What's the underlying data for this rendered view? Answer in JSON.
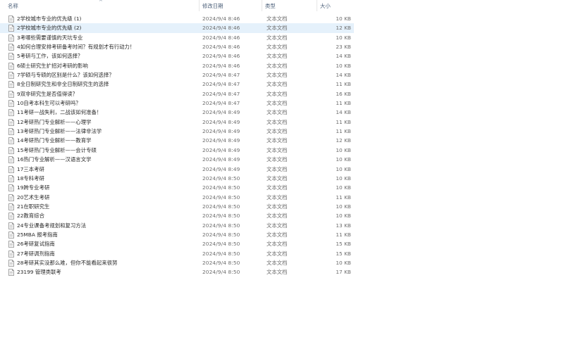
{
  "columns": {
    "name": "名称",
    "date": "修改日期",
    "type": "类型",
    "size": "大小"
  },
  "icons": {
    "sort": "sort-up-icon",
    "file": "text-file-icon"
  },
  "files": [
    {
      "name": "2学校城市专业的优先级 (1)",
      "date": "2024/9/4 8:46",
      "type": "文本文档",
      "size": "10 KB",
      "selected": false
    },
    {
      "name": "2学校城市专业的优先级 (2)",
      "date": "2024/9/4 8:46",
      "type": "文本文档",
      "size": "12 KB",
      "selected": true
    },
    {
      "name": "3考哪些需要谨慎的天坑专业",
      "date": "2024/9/4 8:46",
      "type": "文本文档",
      "size": "10 KB",
      "selected": false
    },
    {
      "name": "4如何合理安排考研备考时间？有规划才有行动力！",
      "date": "2024/9/4 8:46",
      "type": "文本文档",
      "size": "23 KB",
      "selected": false
    },
    {
      "name": "5考研与工作，该如何选择？",
      "date": "2024/9/4 8:46",
      "type": "文本文档",
      "size": "14 KB",
      "selected": false
    },
    {
      "name": "6硕士研究生扩招对考研的影响",
      "date": "2024/9/4 8:46",
      "type": "文本文档",
      "size": "10 KB",
      "selected": false
    },
    {
      "name": "7学硕与专硕的区别是什么？该如何选择？",
      "date": "2024/9/4 8:47",
      "type": "文本文档",
      "size": "14 KB",
      "selected": false
    },
    {
      "name": "8全日制研究生和非全日制研究生的选择",
      "date": "2024/9/4 8:47",
      "type": "文本文档",
      "size": "11 KB",
      "selected": false
    },
    {
      "name": "9双非研究生是否值得读？",
      "date": "2024/9/4 8:47",
      "type": "文本文档",
      "size": "16 KB",
      "selected": false
    },
    {
      "name": "10自考本科生可以考研吗？",
      "date": "2024/9/4 8:47",
      "type": "文本文档",
      "size": "11 KB",
      "selected": false
    },
    {
      "name": "11考研一战失利，二战该如何准备！",
      "date": "2024/9/4 8:49",
      "type": "文本文档",
      "size": "14 KB",
      "selected": false
    },
    {
      "name": "12考研热门专业解析——心理学",
      "date": "2024/9/4 8:49",
      "type": "文本文档",
      "size": "11 KB",
      "selected": false
    },
    {
      "name": "13考研热门专业解析——法律非法学",
      "date": "2024/9/4 8:49",
      "type": "文本文档",
      "size": "11 KB",
      "selected": false
    },
    {
      "name": "14考研热门专业解析——教育学",
      "date": "2024/9/4 8:49",
      "type": "文本文档",
      "size": "12 KB",
      "selected": false
    },
    {
      "name": "15考研热门专业解析——会计专硕",
      "date": "2024/9/4 8:49",
      "type": "文本文档",
      "size": "10 KB",
      "selected": false
    },
    {
      "name": "16热门专业解析——汉语言文学",
      "date": "2024/9/4 8:49",
      "type": "文本文档",
      "size": "10 KB",
      "selected": false
    },
    {
      "name": "17三本考研",
      "date": "2024/9/4 8:49",
      "type": "文本文档",
      "size": "10 KB",
      "selected": false
    },
    {
      "name": "18专科考研",
      "date": "2024/9/4 8:50",
      "type": "文本文档",
      "size": "10 KB",
      "selected": false
    },
    {
      "name": "19跨专业考研",
      "date": "2024/9/4 8:50",
      "type": "文本文档",
      "size": "10 KB",
      "selected": false
    },
    {
      "name": "20艺术生考研",
      "date": "2024/9/4 8:50",
      "type": "文本文档",
      "size": "11 KB",
      "selected": false
    },
    {
      "name": "21在职研究生",
      "date": "2024/9/4 8:50",
      "type": "文本文档",
      "size": "10 KB",
      "selected": false
    },
    {
      "name": "22教育综合",
      "date": "2024/9/4 8:50",
      "type": "文本文档",
      "size": "10 KB",
      "selected": false
    },
    {
      "name": "24专业课备考规划和复习方法",
      "date": "2024/9/4 8:50",
      "type": "文本文档",
      "size": "13 KB",
      "selected": false
    },
    {
      "name": "25MBA 报考指南",
      "date": "2024/9/4 8:50",
      "type": "文本文档",
      "size": "11 KB",
      "selected": false
    },
    {
      "name": "26考研复试指南",
      "date": "2024/9/4 8:50",
      "type": "文本文档",
      "size": "15 KB",
      "selected": false
    },
    {
      "name": "27考研调剂指南",
      "date": "2024/9/4 8:50",
      "type": "文本文档",
      "size": "15 KB",
      "selected": false
    },
    {
      "name": "28考研其实没那么难，但你不能看起来很努",
      "date": "2024/9/4 8:50",
      "type": "文本文档",
      "size": "10 KB",
      "selected": false
    },
    {
      "name": "23199 管理类联考",
      "date": "2024/9/4 8:50",
      "type": "文本文档",
      "size": "17 KB",
      "selected": false
    }
  ]
}
